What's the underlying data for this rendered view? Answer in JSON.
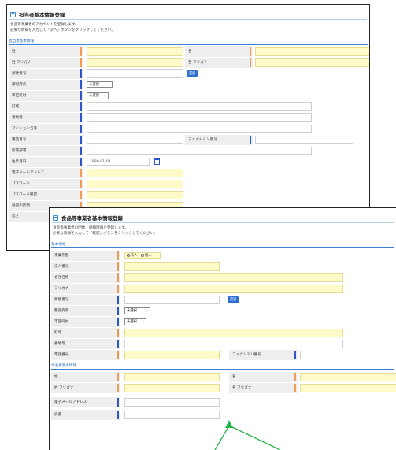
{
  "panel1": {
    "title": "担当者基本情報登録",
    "desc1": "食品等事業者のアカウントを登録します。",
    "desc2": "必要な情報を入力して「次へ」ボタンをクリックしてください。",
    "section": "担当者基本情報",
    "labels": {
      "sei": "姓",
      "mei": "名",
      "sei_kana": "姓 フリガナ",
      "mei_kana": "名 フリガナ",
      "zip": "郵便番号",
      "pref": "都道府県",
      "city": "市区町村",
      "town": "町域",
      "banchi": "番地等",
      "building": "マンション名等",
      "tel": "電話番号",
      "fax": "ファクシミリ番号",
      "dept": "所属部署",
      "birth": "生年月日",
      "email": "電子メールアドレス",
      "password": "パスワード",
      "password_confirm": "パスワード確認",
      "secret_q": "秘密の質問",
      "answer": "答え"
    },
    "zip_button": "選択",
    "pref_value": "未選択",
    "city_value": "未選択",
    "birth_value": "1980-01-01"
  },
  "panel2": {
    "title": "食品等事業者基本情報登録",
    "desc1": "食品等事業者の団体・組織情報を登録します。",
    "desc2": "必要な情報を入力して「確認」ボタンをクリックしてください。",
    "section_basic": "基本情報",
    "section_rep": "代表者基本情報",
    "labels": {
      "type": "事業形態",
      "corp_no": "法人番号",
      "company": "会社名称",
      "kana": "フリガナ",
      "zip": "郵便番号",
      "pref": "都道府県",
      "city": "市区町村",
      "town": "町域",
      "banchi": "番地等",
      "tel": "電話番号",
      "fax": "ファクシミリ番号",
      "rep_sei": "姓",
      "rep_mei": "名",
      "rep_sei_kana": "姓 フリガナ",
      "rep_mei_kana": "名 フリガナ",
      "email": "電子メールアドレス",
      "position": "肩書"
    },
    "type_options": [
      "法人",
      "個人"
    ],
    "type_selected": "法人",
    "zip_button": "選択",
    "pref_value": "未選択",
    "city_value": "未選択"
  },
  "colors": {
    "required_marker": "#ef9a55",
    "optional_marker": "#2c57c8",
    "required_field": "#fffbc9",
    "button": "#2f6fd1",
    "arrow": "#27b548"
  }
}
